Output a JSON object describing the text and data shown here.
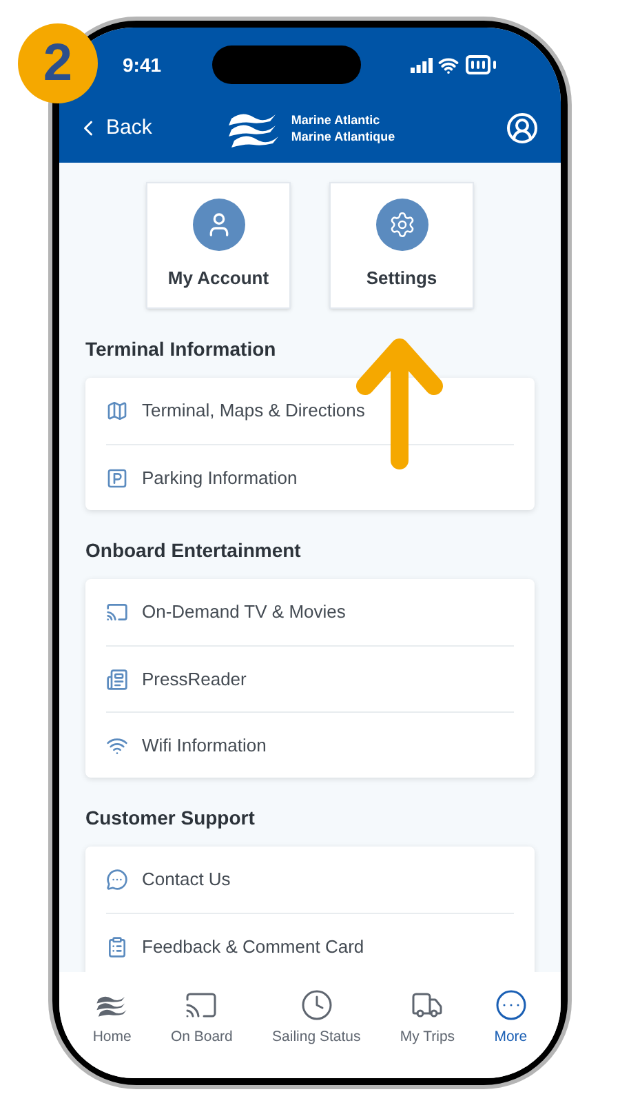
{
  "step_badge": "2",
  "status_bar": {
    "time": "9:41"
  },
  "header": {
    "back": "Back",
    "brand_lines": [
      "Marine Atlantic",
      "Marine Atlantique"
    ]
  },
  "tiles": [
    {
      "label": "My Account",
      "kind": "account"
    },
    {
      "label": "Settings",
      "kind": "settings"
    }
  ],
  "sections": [
    {
      "title": "Terminal Information",
      "items": [
        {
          "label": "Terminal, Maps & Directions",
          "kind": "map"
        },
        {
          "label": "Parking Information",
          "kind": "parking"
        }
      ]
    },
    {
      "title": "Onboard Entertainment",
      "items": [
        {
          "label": "On-Demand TV & Movies",
          "kind": "tv"
        },
        {
          "label": "PressReader",
          "kind": "news"
        },
        {
          "label": "Wifi Information",
          "kind": "wifi"
        }
      ]
    },
    {
      "title": "Customer Support",
      "items": [
        {
          "label": "Contact Us",
          "kind": "chat"
        },
        {
          "label": "Feedback & Comment Card",
          "kind": "form"
        }
      ]
    }
  ],
  "tab_bar": [
    {
      "label": "Home",
      "kind": "home",
      "selected": false
    },
    {
      "label": "On Board",
      "kind": "tv",
      "selected": false
    },
    {
      "label": "Sailing Status",
      "kind": "clock",
      "selected": false
    },
    {
      "label": "My Trips",
      "kind": "truck",
      "selected": false
    },
    {
      "label": "More",
      "kind": "more",
      "selected": true
    }
  ]
}
